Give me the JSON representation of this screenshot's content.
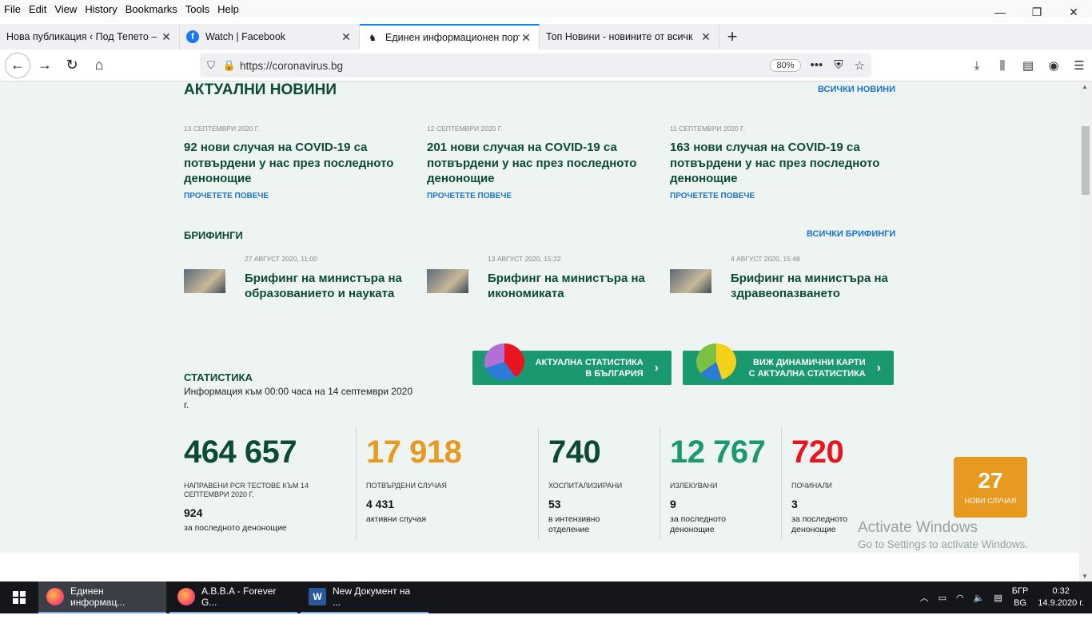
{
  "menu": [
    "File",
    "Edit",
    "View",
    "History",
    "Bookmarks",
    "Tools",
    "Help"
  ],
  "window_controls": [
    "—",
    "❐",
    "✕"
  ],
  "tabs": [
    {
      "title": "Нова публикация ‹ Под Тепето – И",
      "active": false
    },
    {
      "title": "Watch | Facebook",
      "active": false
    },
    {
      "title": "Единен информационен порт",
      "active": true
    },
    {
      "title": "Топ Новини - новините от всичк",
      "active": false
    }
  ],
  "address": {
    "url": "https://coronavirus.bg",
    "zoom": "80%"
  },
  "news": {
    "heading": "АКТУАЛНИ НОВИНИ",
    "all_link": "ВСИЧКИ НОВИНИ",
    "items": [
      {
        "date": "13 СЕПТЕМВРИ 2020 Г.",
        "title": "92 нови случая на COVID-19 са потвърдени у нас през последното денонощие",
        "more": "ПРОЧЕТЕТЕ ПОВЕЧЕ"
      },
      {
        "date": "12 СЕПТЕМВРИ 2020 Г.",
        "title": "201 нови случая на COVID-19 са потвърдени у нас през последното денонощие",
        "more": "ПРОЧЕТЕТЕ ПОВЕЧЕ"
      },
      {
        "date": "11 СЕПТЕМВРИ 2020 Г.",
        "title": "163 нови случая на COVID-19 са потвърдени у нас през последното денонощие",
        "more": "ПРОЧЕТЕТЕ ПОВЕЧЕ"
      }
    ]
  },
  "briefings": {
    "heading": "БРИФИНГИ",
    "all_link": "ВСИЧКИ БРИФИНГИ",
    "items": [
      {
        "date": "27 АВГУСТ 2020, 11:00",
        "title": "Брифинг на министъра на образованието и науката"
      },
      {
        "date": "13 АВГУСТ 2020, 15:22",
        "title": "Брифинг на министъра на икономиката"
      },
      {
        "date": "4 АВГУСТ 2020, 15:48",
        "title": "Брифинг на министъра на здравеопазването"
      }
    ]
  },
  "stat_buttons": [
    {
      "line1": "АКТУАЛНА СТАТИСТИКА",
      "line2": "В БЪЛГАРИЯ"
    },
    {
      "line1": "ВИЖ ДИНАМИЧНИ КАРТИ",
      "line2": "С АКТУАЛНА СТАТИСТИКА"
    }
  ],
  "statistics": {
    "heading": "СТАТИСТИКА",
    "info": "Информация към 00:00 часа на 14 септември 2020 г.",
    "cards": [
      {
        "value": "464 657",
        "color": "#0b4a35",
        "label": "НАПРАВЕНИ PCR ТЕСТОВЕ КЪМ 14 СЕПТЕМВРИ 2020 Г.",
        "sub_value": "924",
        "sub_label": "за последното денонощие"
      },
      {
        "value": "17 918",
        "color": "#e89a20",
        "label": "ПОТВЪРДЕНИ СЛУЧАЯ",
        "sub_value": "4 431",
        "sub_label": "активни случая"
      },
      {
        "value": "740",
        "color": "#0b4a35",
        "label": "ХОСПИТАЛИЗИРАНИ",
        "sub_value": "53",
        "sub_label": "в интензивно отделение"
      },
      {
        "value": "12 767",
        "color": "#1a9870",
        "label": "ИЗЛЕКУВАНИ",
        "sub_value": "9",
        "sub_label": "за последното денонощие"
      },
      {
        "value": "720",
        "color": "#e8141e",
        "label": "ПОЧИНАЛИ",
        "sub_value": "3",
        "sub_label": "за последното денонощие"
      }
    ],
    "new_cases": {
      "value": "27",
      "label": "НОВИ СЛУЧАЯ"
    }
  },
  "activation": {
    "line1": "Activate Windows",
    "line2": "Go to Settings to activate Windows."
  },
  "taskbar": {
    "apps": [
      {
        "label": "Единен информац...",
        "active": true
      },
      {
        "label": "A.B.B.A - Forever G...",
        "active": false
      },
      {
        "label": "New Документ на ...",
        "active": false
      }
    ],
    "lang1": "БГР",
    "lang2": "BG",
    "time": "0:32",
    "date": "14.9.2020 г."
  }
}
